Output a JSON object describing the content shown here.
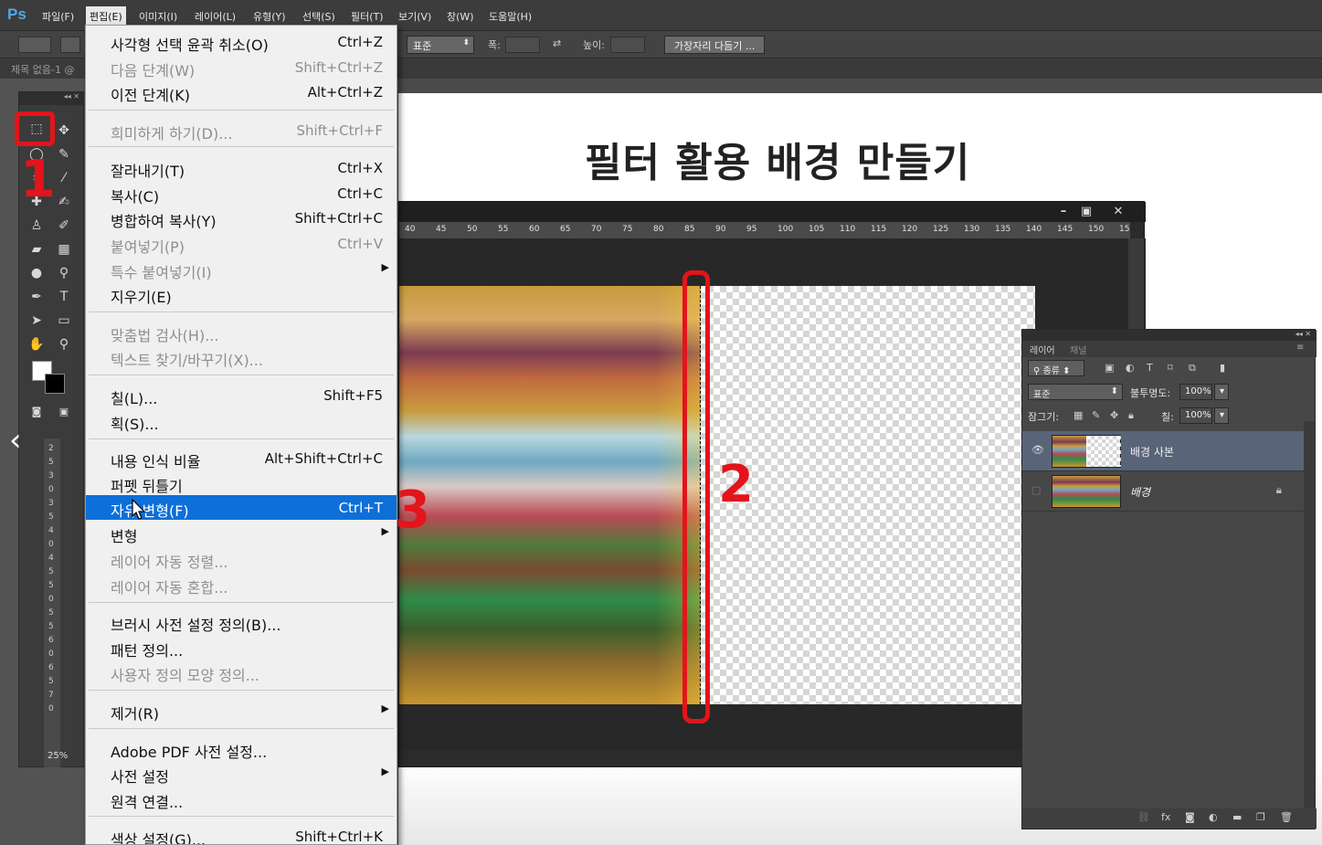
{
  "app": {
    "logo": "Ps"
  },
  "menubar": {
    "items": [
      "파일(F)",
      "편집(E)",
      "이미지(I)",
      "레이어(L)",
      "유형(Y)",
      "선택(S)",
      "필터(T)",
      "보기(V)",
      "창(W)",
      "도움말(H)"
    ]
  },
  "options": {
    "style_value": "표준",
    "width_label": "폭:",
    "height_label": "높이:",
    "refine_button": "가장자리 다듬기 ..."
  },
  "document": {
    "tab_title": "제목 없음-1 @",
    "zoom": "25%"
  },
  "slide": {
    "title": "필터 활용 배경 만들기"
  },
  "inner_ruler": [
    "40",
    "45",
    "50",
    "55",
    "60",
    "65",
    "70",
    "75",
    "80",
    "85",
    "90",
    "95",
    "100",
    "105",
    "110",
    "115",
    "120",
    "125",
    "130",
    "135",
    "140",
    "145",
    "150",
    "15"
  ],
  "vruler": [
    "2",
    "5",
    "3",
    "0",
    "3",
    "5",
    "4",
    "0",
    "4",
    "5",
    "5",
    "0",
    "5",
    "5",
    "6",
    "0",
    "6",
    "5",
    "7",
    "0"
  ],
  "annotations": {
    "one": "1",
    "two": "2",
    "three": "3"
  },
  "edit_menu": {
    "items": [
      {
        "label": "사각형 선택 윤곽 취소(O)",
        "shortcut": "Ctrl+Z",
        "disabled": false
      },
      {
        "label": "다음 단계(W)",
        "shortcut": "Shift+Ctrl+Z",
        "disabled": true
      },
      {
        "label": "이전 단계(K)",
        "shortcut": "Alt+Ctrl+Z",
        "disabled": false
      },
      {
        "label": "희미하게 하기(D)...",
        "shortcut": "Shift+Ctrl+F",
        "disabled": true
      },
      {
        "label": "잘라내기(T)",
        "shortcut": "Ctrl+X",
        "disabled": false
      },
      {
        "label": "복사(C)",
        "shortcut": "Ctrl+C",
        "disabled": false
      },
      {
        "label": "병합하여 복사(Y)",
        "shortcut": "Shift+Ctrl+C",
        "disabled": false
      },
      {
        "label": "붙여넣기(P)",
        "shortcut": "Ctrl+V",
        "disabled": true
      },
      {
        "label": "특수 붙여넣기(I)",
        "shortcut": "",
        "disabled": true,
        "submenu": true
      },
      {
        "label": "지우기(E)",
        "shortcut": "",
        "disabled": false
      },
      {
        "label": "맞춤법 검사(H)...",
        "shortcut": "",
        "disabled": true
      },
      {
        "label": "텍스트 찾기/바꾸기(X)...",
        "shortcut": "",
        "disabled": true
      },
      {
        "label": "칠(L)...",
        "shortcut": "Shift+F5",
        "disabled": false
      },
      {
        "label": "획(S)...",
        "shortcut": "",
        "disabled": false
      },
      {
        "label": "내용 인식 비율",
        "shortcut": "Alt+Shift+Ctrl+C",
        "disabled": false
      },
      {
        "label": "퍼펫 뒤틀기",
        "shortcut": "",
        "disabled": false
      },
      {
        "label": "자유 변형(F)",
        "shortcut": "Ctrl+T",
        "disabled": false,
        "highlighted": true
      },
      {
        "label": "변형",
        "shortcut": "",
        "disabled": false,
        "submenu": true
      },
      {
        "label": "레이어 자동 정렬...",
        "shortcut": "",
        "disabled": true
      },
      {
        "label": "레이어 자동 혼합...",
        "shortcut": "",
        "disabled": true
      },
      {
        "label": "브러시 사전 설정 정의(B)...",
        "shortcut": "",
        "disabled": false
      },
      {
        "label": "패턴 정의...",
        "shortcut": "",
        "disabled": false
      },
      {
        "label": "사용자 정의 모양 정의...",
        "shortcut": "",
        "disabled": true
      },
      {
        "label": "제거(R)",
        "shortcut": "",
        "disabled": false,
        "submenu": true
      },
      {
        "label": "Adobe PDF 사전 설정...",
        "shortcut": "",
        "disabled": false
      },
      {
        "label": "사전 설정",
        "shortcut": "",
        "disabled": false,
        "submenu": true
      },
      {
        "label": "원격 연결...",
        "shortcut": "",
        "disabled": false
      },
      {
        "label": "색상 설정(G)...",
        "shortcut": "Shift+Ctrl+K",
        "disabled": false
      }
    ]
  },
  "layers_panel": {
    "tab_layers": "레이어",
    "tab_channels": "채널",
    "filter_kind": "종류",
    "blend_mode": "표준",
    "opacity_label": "불투명도:",
    "opacity_value": "100%",
    "lock_label": "잠그기:",
    "fill_label": "칠:",
    "fill_value": "100%",
    "layers": [
      {
        "name": "배경 사본",
        "selected": true,
        "visible": true
      },
      {
        "name": "배경",
        "selected": false,
        "visible": false,
        "locked": true
      }
    ]
  }
}
